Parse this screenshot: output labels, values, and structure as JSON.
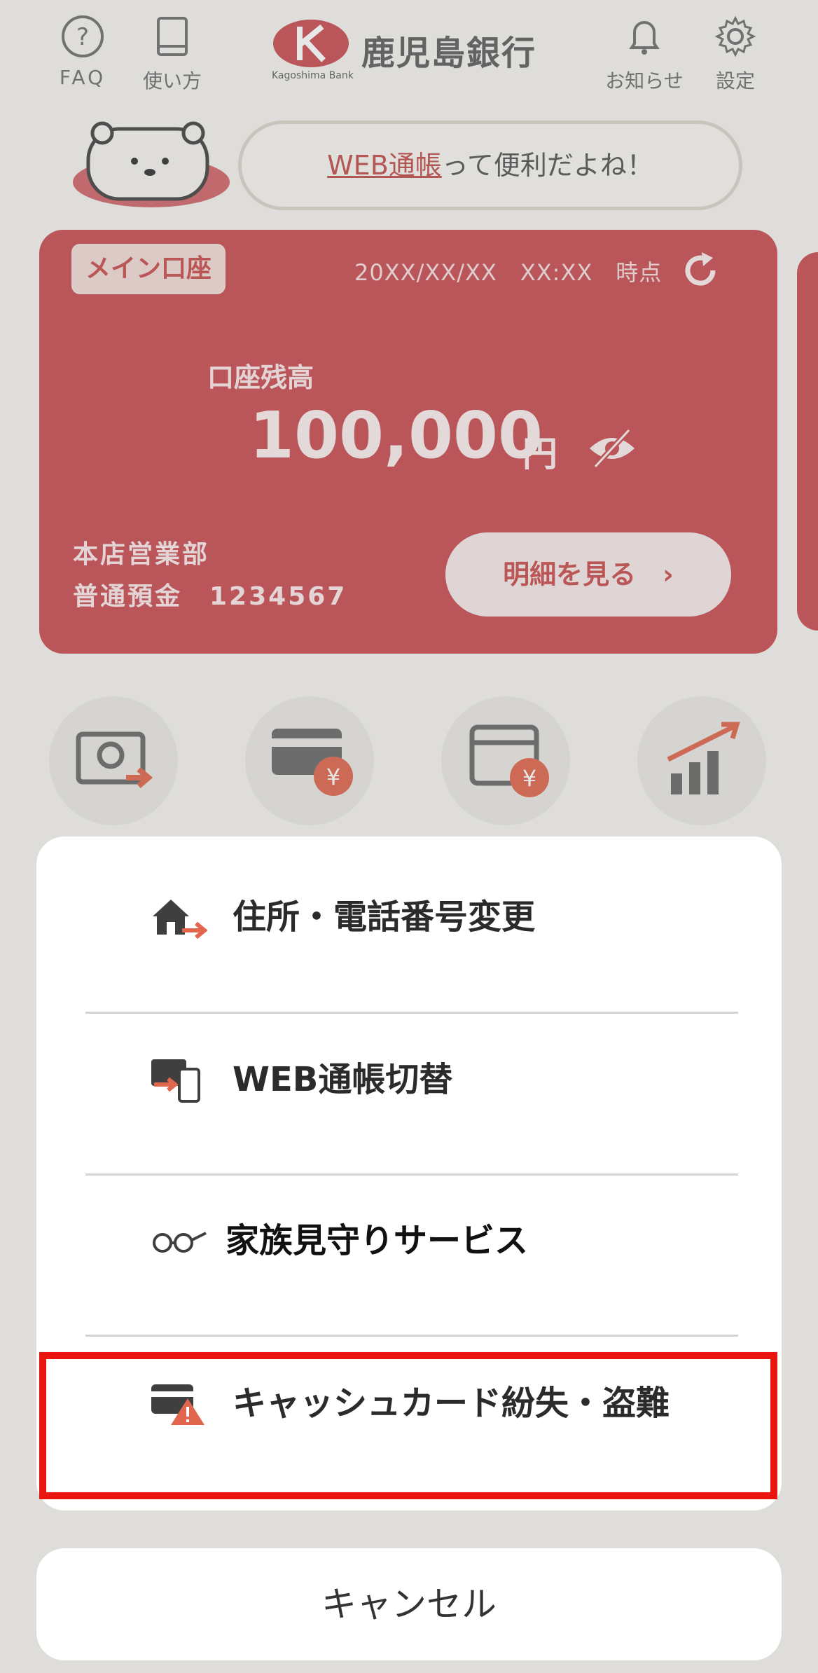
{
  "header": {
    "faq_label": "FAQ",
    "howto_label": "使い方",
    "bank_name": "鹿児島銀行",
    "bank_name_en": "Kagoshima Bank",
    "notice_label": "お知らせ",
    "settings_label": "設定"
  },
  "banner": {
    "link_text": "WEB通帳",
    "rest_text": "って便利だよね！"
  },
  "account": {
    "badge": "メイン口座",
    "timestamp": "20XX/XX/XX　XX:XX　時点",
    "balance_label": "口座残高",
    "balance": "100,000",
    "currency": "円",
    "branch": "本店営業部",
    "account_line": "普通預金　1234567",
    "detail_button": "明細を見る　›"
  },
  "menu": {
    "items": [
      {
        "label": "住所・電話番号変更",
        "icon": "house-arrow-icon"
      },
      {
        "label": "WEB通帳切替",
        "icon": "passbook-switch-icon"
      },
      {
        "label": "家族見守りサービス",
        "icon": "glasses-icon"
      },
      {
        "label": "キャッシュカード紛失・盗難",
        "icon": "card-warning-icon"
      }
    ],
    "cancel_label": "キャンセル"
  },
  "colors": {
    "brand_red": "#c94e54",
    "highlight": "#e8160f"
  }
}
